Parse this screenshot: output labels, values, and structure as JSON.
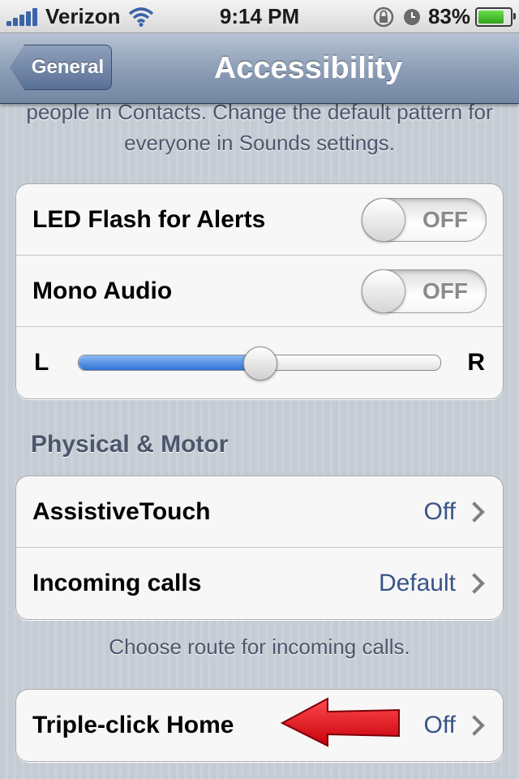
{
  "status_bar": {
    "carrier": "Verizon",
    "time": "9:14 PM",
    "battery_percent": "83%",
    "battery_level": 0.83,
    "icons": [
      "signal-bars-icon",
      "wifi-icon",
      "rotation-lock-icon",
      "alarm-icon",
      "battery-icon"
    ]
  },
  "nav": {
    "back_label": "General",
    "title": "Accessibility"
  },
  "intro_text": "people in Contacts. Change the default pattern for everyone in Sounds settings.",
  "hearing_group": {
    "led_flash": {
      "label": "LED Flash for Alerts",
      "state": "OFF"
    },
    "mono_audio": {
      "label": "Mono Audio",
      "state": "OFF"
    },
    "balance": {
      "left_label": "L",
      "right_label": "R",
      "value": 0.5
    }
  },
  "physical_motor": {
    "header": "Physical & Motor",
    "assistive_touch": {
      "label": "AssistiveTouch",
      "value": "Off"
    },
    "incoming_calls": {
      "label": "Incoming calls",
      "value": "Default"
    },
    "footer": "Choose route for incoming calls."
  },
  "triple_click": {
    "label": "Triple-click Home",
    "value": "Off"
  },
  "colors": {
    "value_blue": "#385487",
    "section_text": "#4c566c",
    "arrow_red": "#e8121a"
  }
}
